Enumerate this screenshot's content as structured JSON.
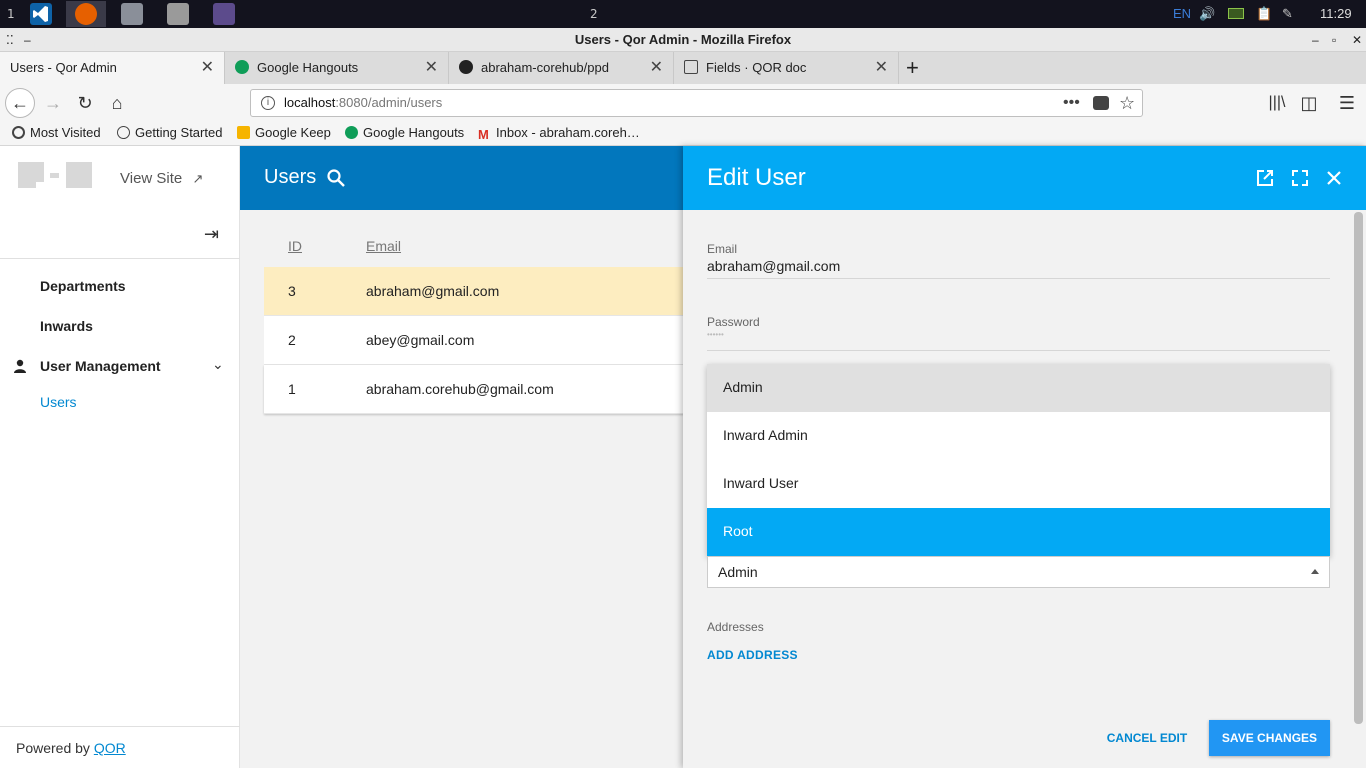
{
  "taskbar": {
    "workspace_1": "1",
    "workspace_2": "2",
    "lang": "EN",
    "clock": "11:29",
    "icons": [
      "vscode-icon",
      "firefox-icon",
      "database-icon",
      "folder-icon",
      "image-viewer-icon"
    ]
  },
  "window": {
    "title": "Users - Qor Admin - Mozilla Firefox"
  },
  "tabs": [
    {
      "label": "Users - Qor Admin",
      "active": true
    },
    {
      "label": "Google Hangouts",
      "active": false
    },
    {
      "label": "abraham-corehub/ppd",
      "active": false
    },
    {
      "label": "Fields · QOR doc",
      "active": false
    }
  ],
  "urlbar": {
    "host": "localhost",
    "rest": ":8080/admin/users"
  },
  "bookmarks": [
    {
      "label": "Most Visited"
    },
    {
      "label": "Getting Started"
    },
    {
      "label": "Google Keep"
    },
    {
      "label": "Google Hangouts"
    },
    {
      "label": "Inbox - abraham.coreh…"
    }
  ],
  "sidebar": {
    "view_site": "View Site",
    "items": [
      {
        "label": "Departments"
      },
      {
        "label": "Inwards"
      },
      {
        "label": "User Management"
      }
    ],
    "sub_items": [
      {
        "label": "Users"
      }
    ],
    "powered_prefix": "Powered by ",
    "powered_link": "QOR"
  },
  "main": {
    "title": "Users",
    "columns": [
      "ID",
      "Email"
    ],
    "rows": [
      {
        "id": "3",
        "email": "abraham@gmail.com"
      },
      {
        "id": "2",
        "email": "abey@gmail.com"
      },
      {
        "id": "1",
        "email": "abraham.corehub@gmail.com"
      }
    ]
  },
  "panel": {
    "title": "Edit User",
    "email_label": "Email",
    "email_value": "abraham@gmail.com",
    "password_label": "Password",
    "password_value": "••••••",
    "role_options": [
      "Admin",
      "Inward Admin",
      "Inward User",
      "Root"
    ],
    "role_selected": "Admin",
    "addresses_label": "Addresses",
    "add_address": "ADD ADDRESS",
    "cancel": "CANCEL EDIT",
    "save": "SAVE CHANGES"
  },
  "colors": {
    "accent": "#03a9f4",
    "header": "#0277bd",
    "selected_row": "#fdedc0",
    "save_button": "#2196f3"
  }
}
